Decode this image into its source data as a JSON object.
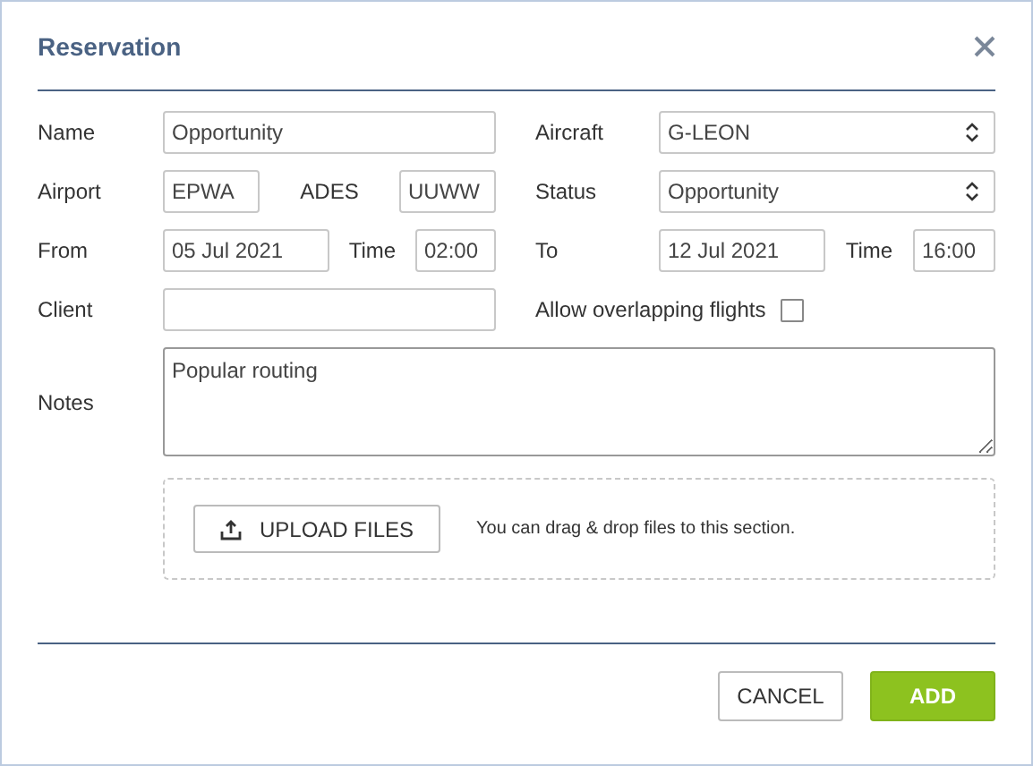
{
  "window": {
    "title": "Reservation"
  },
  "name": {
    "label": "Name",
    "value": "Opportunity"
  },
  "aircraft": {
    "label": "Aircraft",
    "value": "G-LEON"
  },
  "airport": {
    "label": "Airport",
    "value": "EPWA"
  },
  "ades": {
    "label": "ADES",
    "value": "UUWW"
  },
  "status": {
    "label": "Status",
    "value": "Opportunity"
  },
  "from": {
    "label": "From",
    "value": "05 Jul 2021"
  },
  "from_time": {
    "label": "Time",
    "value": "02:00"
  },
  "to": {
    "label": "To",
    "value": "12 Jul 2021"
  },
  "to_time": {
    "label": "Time",
    "value": "16:00"
  },
  "client": {
    "label": "Client"
  },
  "allow_overlapping": {
    "label": "Allow overlapping flights",
    "checked": false
  },
  "notes": {
    "label": "Notes",
    "value": "Popular routing"
  },
  "upload": {
    "button": "UPLOAD FILES",
    "hint": "You can drag & drop files to this section."
  },
  "buttons": [
    {
      "label": "CANCEL",
      "kind": "secondary"
    },
    {
      "label": "ADD",
      "kind": "primary"
    }
  ]
}
